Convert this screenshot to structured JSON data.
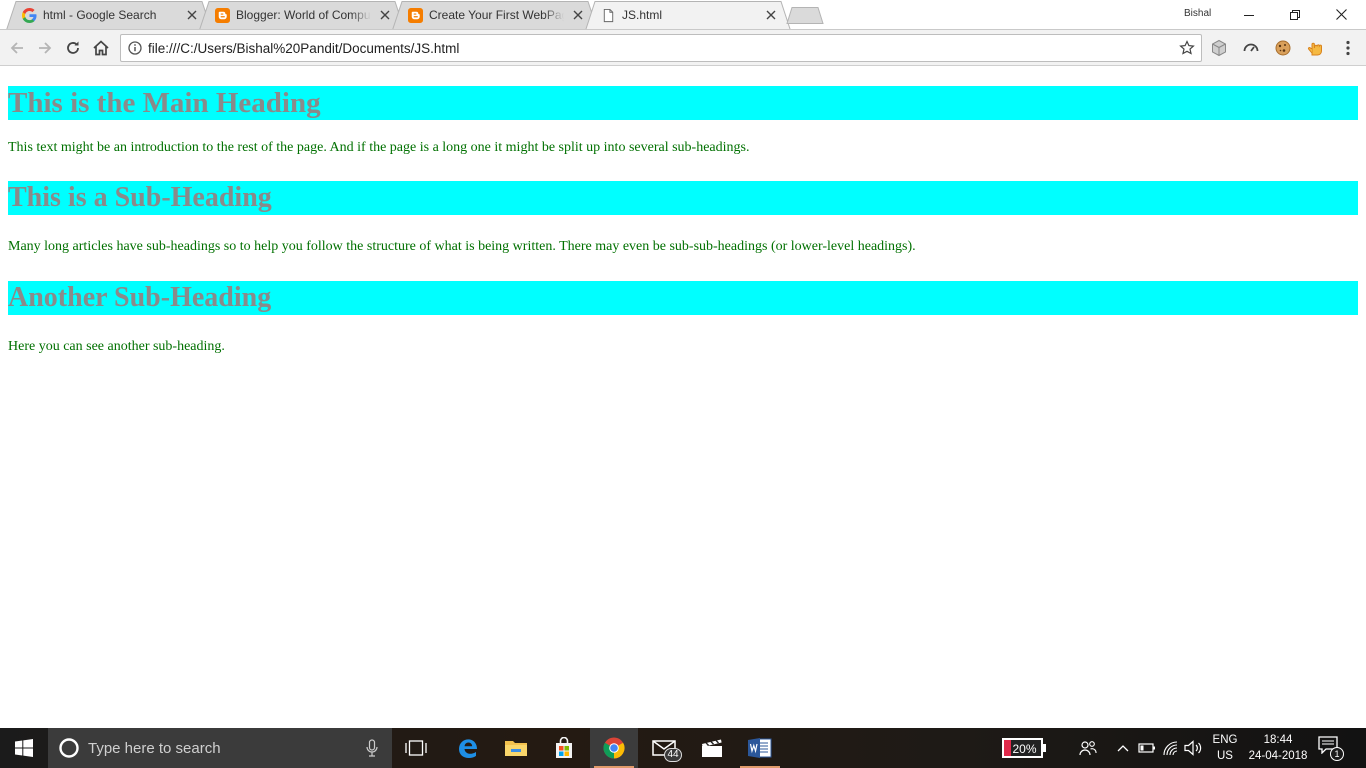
{
  "browser": {
    "tabs": [
      {
        "title": "html - Google Search",
        "favicon": "google-icon",
        "active": false
      },
      {
        "title": "Blogger: World of Compu",
        "favicon": "blogger-icon",
        "active": false
      },
      {
        "title": "Create Your First WebPag",
        "favicon": "blogger-icon",
        "active": false
      },
      {
        "title": "JS.html",
        "favicon": "page-icon",
        "active": true
      }
    ],
    "profile_name": "Bishal",
    "url": "file:///C:/Users/Bishal%20Pandit/Documents/JS.html"
  },
  "page": {
    "main_heading": "This is the Main Heading",
    "intro": "This text might be an introduction to the rest of the page. And if the page is a long one it might be split up into several sub-headings.",
    "sub_heading_1": "This is a Sub-Heading",
    "paragraph_2": "Many long articles have sub-headings so to help you follow the structure of what is being written. There may even be sub-sub-headings (or lower-level headings).",
    "sub_heading_2": "Another Sub-Heading",
    "paragraph_3": "Here you can see another sub-heading.",
    "colors": {
      "heading_bg": "#00ffff",
      "heading_text": "#8a8a8a",
      "paragraph_text": "#007000"
    }
  },
  "taskbar": {
    "search_placeholder": "Type here to search",
    "mail_badge": "44",
    "battery_percent": "20%",
    "battery_level": 0.2,
    "language": "ENG",
    "region": "US",
    "time": "18:44",
    "date": "24-04-2018",
    "notifications_count": "1"
  }
}
